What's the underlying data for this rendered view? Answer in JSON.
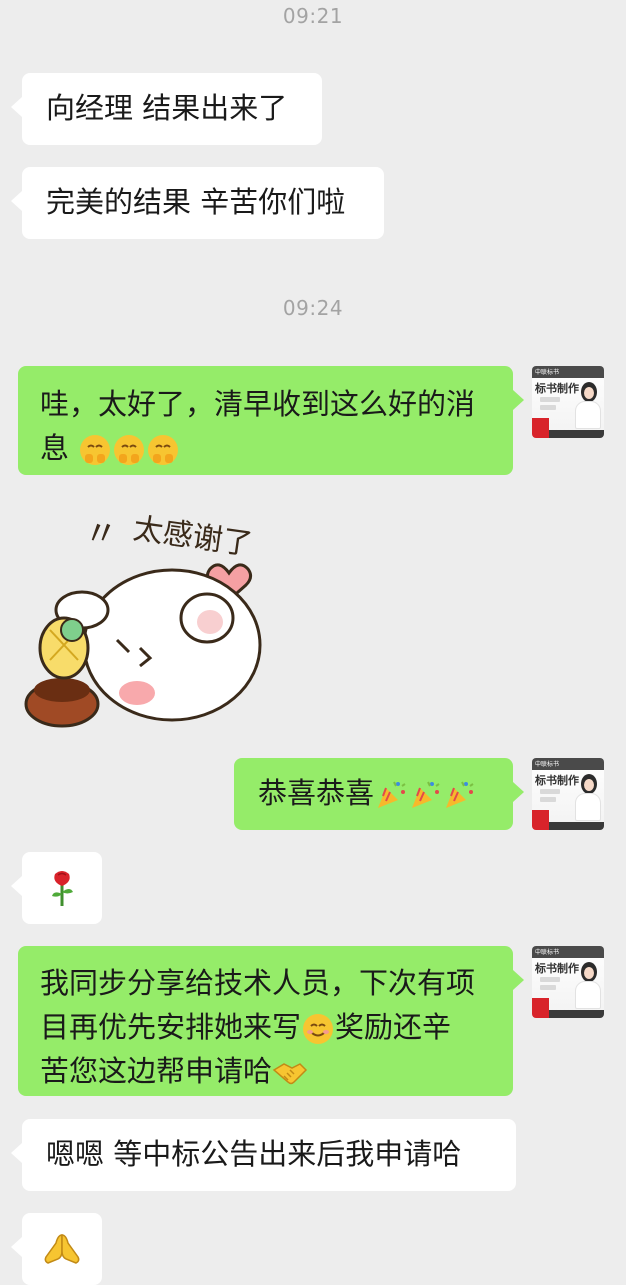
{
  "timestamps": [
    "09:21",
    "09:24"
  ],
  "messages": [
    {
      "side": "left",
      "text": "向经理 结果出来了"
    },
    {
      "side": "left",
      "text": "完美的结果 辛苦你们啦"
    },
    {
      "side": "right",
      "line1": "哇，太好了，清早收到这么好的消",
      "line2": "息"
    },
    {
      "side": "left",
      "type": "sticker",
      "sticker_text": "太感谢了"
    },
    {
      "side": "right",
      "text": "恭喜恭喜"
    },
    {
      "side": "left",
      "type": "emoji",
      "emoji": "rose"
    },
    {
      "side": "right",
      "line1": "我同步分享给技术人员，下次有项",
      "line2a": "目再优先安排她来写",
      "line2b": "奖励还辛",
      "line3": "苦您这边帮申请哈"
    },
    {
      "side": "left",
      "text": "嗯嗯 等中标公告出来后我申请哈"
    },
    {
      "side": "left",
      "type": "emoji",
      "emoji": "folded-hands"
    }
  ],
  "avatar": {
    "top_text": "中联标书",
    "title": "标书制作",
    "badge_line1": "全程",
    "badge_line2": "承接"
  },
  "colors": {
    "background": "#ededed",
    "left_bubble": "#ffffff",
    "right_bubble": "#95ec69",
    "timestamp": "#a3a3a3"
  }
}
